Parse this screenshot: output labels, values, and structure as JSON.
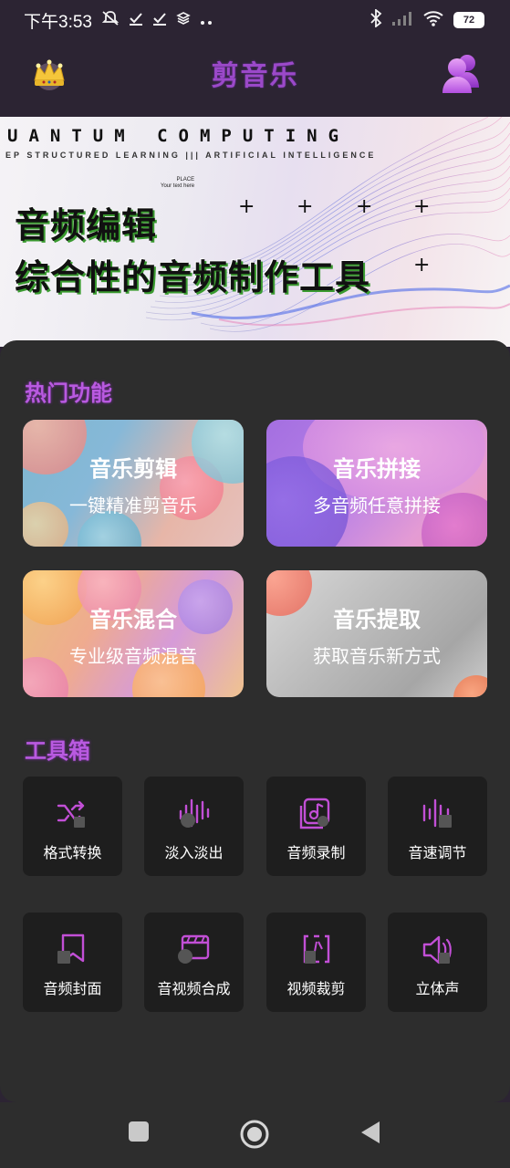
{
  "status_bar": {
    "time": "下午3:53",
    "battery": "72",
    "icons": [
      "mute-icon",
      "check-icon",
      "check-icon",
      "layers-icon",
      "more-dots-icon",
      "bluetooth-icon",
      "signal-icon",
      "wifi-icon",
      "battery-icon"
    ]
  },
  "header": {
    "title": "剪音乐",
    "left_icon": "crown-icon",
    "right_icon": "user-group-icon",
    "accent_color": "#9b49c9"
  },
  "banner": {
    "headline": "UANTUM COMPUTING",
    "subline": "EP STRUCTURED LEARNING ||| ARTIFICIAL INTELLIGENCE",
    "place_line1": "PLACE",
    "place_line2": "Your text here",
    "line1": "音频编辑",
    "line2": "综合性的音频制作工具"
  },
  "hot_features": {
    "title": "热门功能",
    "cards": [
      {
        "title": "音乐剪辑",
        "subtitle": "一键精准剪音乐"
      },
      {
        "title": "音乐拼接",
        "subtitle": "多音频任意拼接"
      },
      {
        "title": "音乐混合",
        "subtitle": "专业级音频混音"
      },
      {
        "title": "音乐提取",
        "subtitle": "获取音乐新方式"
      }
    ]
  },
  "toolbox": {
    "title": "工具箱",
    "icon_color": "#c24fd6",
    "items": [
      {
        "label": "格式转换",
        "icon": "shuffle-convert-icon"
      },
      {
        "label": "淡入淡出",
        "icon": "fade-wave-icon"
      },
      {
        "label": "音频录制",
        "icon": "music-record-icon"
      },
      {
        "label": "音速调节",
        "icon": "speed-bars-icon"
      },
      {
        "label": "音频封面",
        "icon": "bookmark-cover-icon"
      },
      {
        "label": "音视频合成",
        "icon": "clapper-icon"
      },
      {
        "label": "视频裁剪",
        "icon": "crop-frame-icon"
      },
      {
        "label": "立体声",
        "icon": "speaker-icon"
      }
    ]
  },
  "nav_bar": {
    "icons": [
      "recents-square-icon",
      "home-circle-icon",
      "back-triangle-icon"
    ]
  }
}
